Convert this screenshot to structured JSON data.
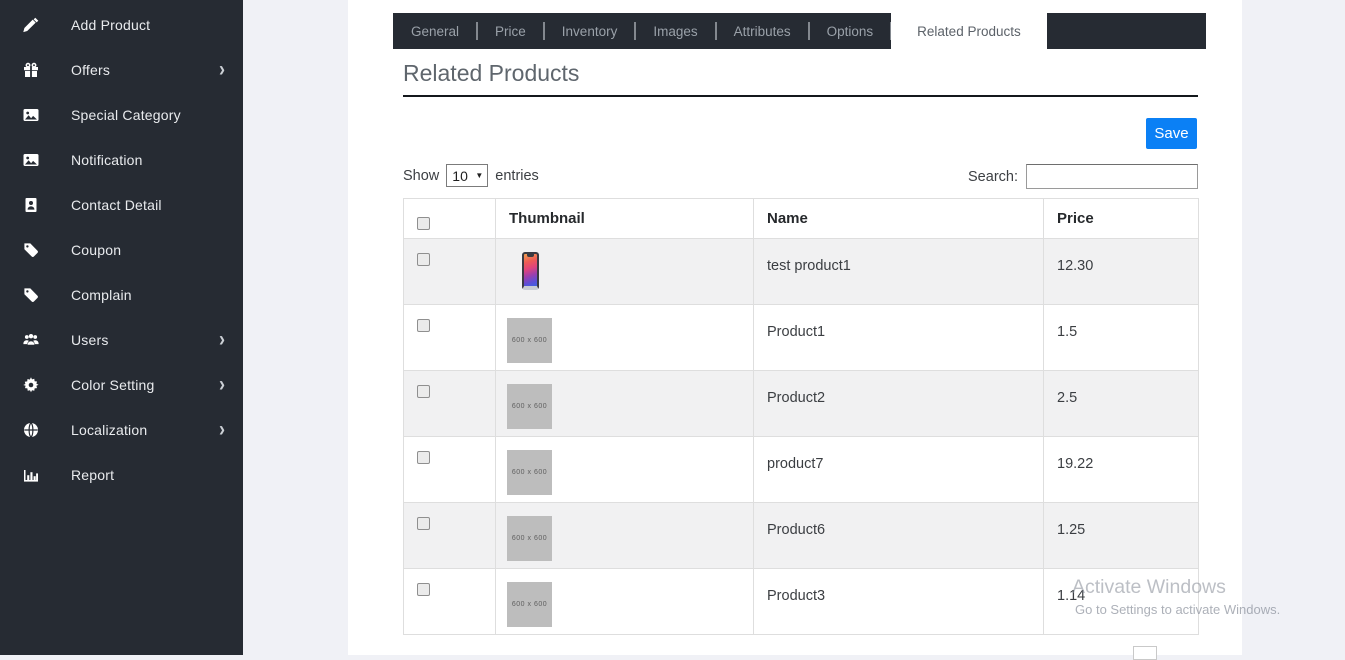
{
  "sidebar": {
    "items": [
      {
        "label": "Add Product",
        "icon": "pen-icon",
        "has_submenu": false
      },
      {
        "label": "Offers",
        "icon": "gift-icon",
        "has_submenu": true
      },
      {
        "label": "Special Category",
        "icon": "image-icon",
        "has_submenu": false
      },
      {
        "label": "Notification",
        "icon": "image-icon",
        "has_submenu": false
      },
      {
        "label": "Contact Detail",
        "icon": "contact-card-icon",
        "has_submenu": false
      },
      {
        "label": "Coupon",
        "icon": "tag-icon",
        "has_submenu": false
      },
      {
        "label": "Complain",
        "icon": "tag-icon",
        "has_submenu": false
      },
      {
        "label": "Users",
        "icon": "users-icon",
        "has_submenu": true
      },
      {
        "label": "Color Setting",
        "icon": "gear-icon",
        "has_submenu": true
      },
      {
        "label": "Localization",
        "icon": "globe-icon",
        "has_submenu": true
      },
      {
        "label": "Report",
        "icon": "bar-chart-icon",
        "has_submenu": false
      }
    ]
  },
  "tabs": {
    "items": [
      {
        "label": "General",
        "active": false
      },
      {
        "label": "Price",
        "active": false
      },
      {
        "label": "Inventory",
        "active": false
      },
      {
        "label": "Images",
        "active": false
      },
      {
        "label": "Attributes",
        "active": false
      },
      {
        "label": "Options",
        "active": false
      },
      {
        "label": "Related Products",
        "active": true
      }
    ]
  },
  "panel": {
    "heading": "Related Products",
    "save_label": "Save"
  },
  "table_controls": {
    "show_label": "Show",
    "page_size": "10",
    "entries_label": "entries",
    "search_label": "Search:",
    "search_value": ""
  },
  "table": {
    "headers": [
      "Thumbnail",
      "Name",
      "Price"
    ],
    "select_all_checked": false,
    "placeholder_text": "600 x 600",
    "rows": [
      {
        "name": "test product1",
        "price": "12.30",
        "thumbnail": "phone-image",
        "checked": false
      },
      {
        "name": "Product1",
        "price": "1.5",
        "thumbnail": "placeholder-600x600",
        "checked": false
      },
      {
        "name": "Product2",
        "price": "2.5",
        "thumbnail": "placeholder-600x600",
        "checked": false
      },
      {
        "name": "product7",
        "price": "19.22",
        "thumbnail": "placeholder-600x600",
        "checked": false
      },
      {
        "name": "Product6",
        "price": "1.25",
        "thumbnail": "placeholder-600x600",
        "checked": false
      },
      {
        "name": "Product3",
        "price": "1.14",
        "thumbnail": "placeholder-600x600",
        "checked": false
      }
    ]
  },
  "watermark": {
    "line1": "Activate Windows",
    "line2": "Go to Settings to activate Windows."
  },
  "colors": {
    "sidebar_bg": "#262b33",
    "accent_blue": "#0b80f5",
    "page_bg": "#f0f1f6",
    "row_stripe": "#f1f1f2"
  }
}
